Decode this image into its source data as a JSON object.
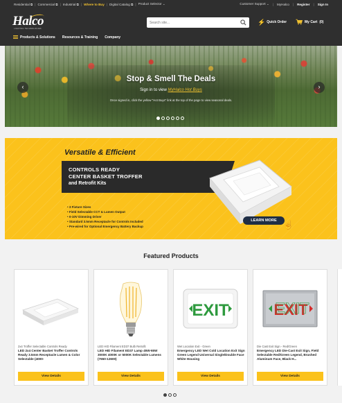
{
  "topbar": {
    "left_links": [
      "Residential ⧉",
      "Commercial ⧉",
      "Industrial ⧉",
      "Where to Buy",
      "Digital Catalog ⧉",
      "Product Selector"
    ],
    "customer_support": "Customer Support",
    "my_haleo": "MyHalco",
    "register": "Register",
    "sign_in": "Sign In"
  },
  "logo": {
    "word": "Halco",
    "tagline": "LIGHTING TECHNOLOGIES"
  },
  "search": {
    "placeholder": "Search site..."
  },
  "quick_order": "Quick Order",
  "cart": {
    "label": "My Cart",
    "count": "(0)"
  },
  "nav": [
    "Products & Solutions",
    "Resources & Training",
    "Company"
  ],
  "hero": {
    "headline": "Stop & Smell The Deals",
    "signin_prefix": "Sign in to view",
    "signin_link": "MyHalco Hot Buys",
    "note": "Once signed in, click the yellow \"Hot Buys\" link at the top of the page to view seasonal deals.",
    "slide_count": 6,
    "active_slide": 0,
    "prev_arrow": "‹",
    "next_arrow": "›"
  },
  "promo": {
    "heading": "Versatile & Efficient",
    "line1": "CONTROLS READY",
    "line2": "CENTER BASKET TROFFER",
    "line3": "and Retrofit Kits",
    "bullets": [
      "• 3 Fixture Sizes",
      "• Field Selectable CCT & Lumen Output",
      "• 0-10V Dimming Driver",
      "• Standard 3.5mm Receptacle for Controls Included",
      "• Pre-wired for Optional Emergency Battery Backup"
    ],
    "cta": "LEARN MORE"
  },
  "featured": {
    "title": "Featured Products",
    "products": [
      {
        "category": "2x4 Troffer Selectable Controls Ready",
        "name": "LED 2x4 Center Basket Troffer Controls Ready 3.5mm Receptacle Lumen & Color Selectable (4000-",
        "button": "View Details",
        "image": "troffer-image"
      },
      {
        "category": "LED HID Filament ED37 Bulb Retrofit",
        "name": "LED HID Filament ED37 Lamp 45W-65W 3000K 4000K or 5000K Selectable Lumens (7650-12600)",
        "button": "View Details",
        "image": "filament-bulb-image"
      },
      {
        "category": "Wet Location Exit - Green",
        "name": "Emergency LED Wet Cold Location Exit Sign Green Legend Universal Single/Double Face White Housing",
        "button": "View Details",
        "image": "exit-sign-green-image"
      },
      {
        "category": "Die Cast Exit Sign - Red/Green",
        "name": "Emergency LED Die-Cast Exit Sign, Field Selectable Red/Green Legend, Brushed Aluminum Face, Black H...",
        "button": "View Details",
        "image": "exit-sign-diecast-image"
      }
    ],
    "page_count": 3,
    "active_page": 0
  },
  "colors": {
    "header_bg": "#2f2f2f",
    "accent_yellow": "#fbc21c",
    "page_bg": "#f2f2f2",
    "exit_green": "#2e9a3e",
    "exit_red": "#d62a2a"
  }
}
